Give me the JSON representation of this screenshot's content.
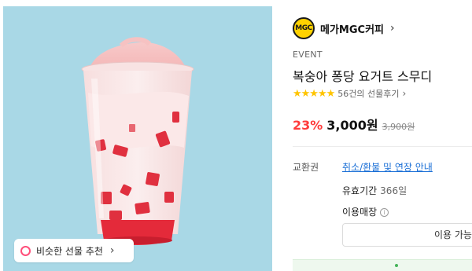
{
  "product_image": {
    "similar_gift_label": "비슷한 선물 추천",
    "colors": {
      "background": "#a9d8e6",
      "accent": "#ff4f7a"
    }
  },
  "brand": {
    "logo_text": "MGC",
    "name": "메가MGC커피",
    "colors": {
      "logo_bg": "#ffd200"
    }
  },
  "event_label": "EVENT",
  "title": "복숭아 퐁당 요거트 스무디",
  "rating": {
    "stars": "★★★★★",
    "review_text": "56건의 선물후기"
  },
  "price": {
    "discount": "23%",
    "current": "3,000원",
    "original": "3,900원",
    "colors": {
      "discount": "#ff3b3b"
    }
  },
  "details": {
    "exchange_label": "교환권",
    "exchange_link": "취소/환불 및 연장 안내",
    "validity_label": "유효기간",
    "validity_value": "366일",
    "store_label": "이용매장",
    "store_button": "이용 가능"
  }
}
